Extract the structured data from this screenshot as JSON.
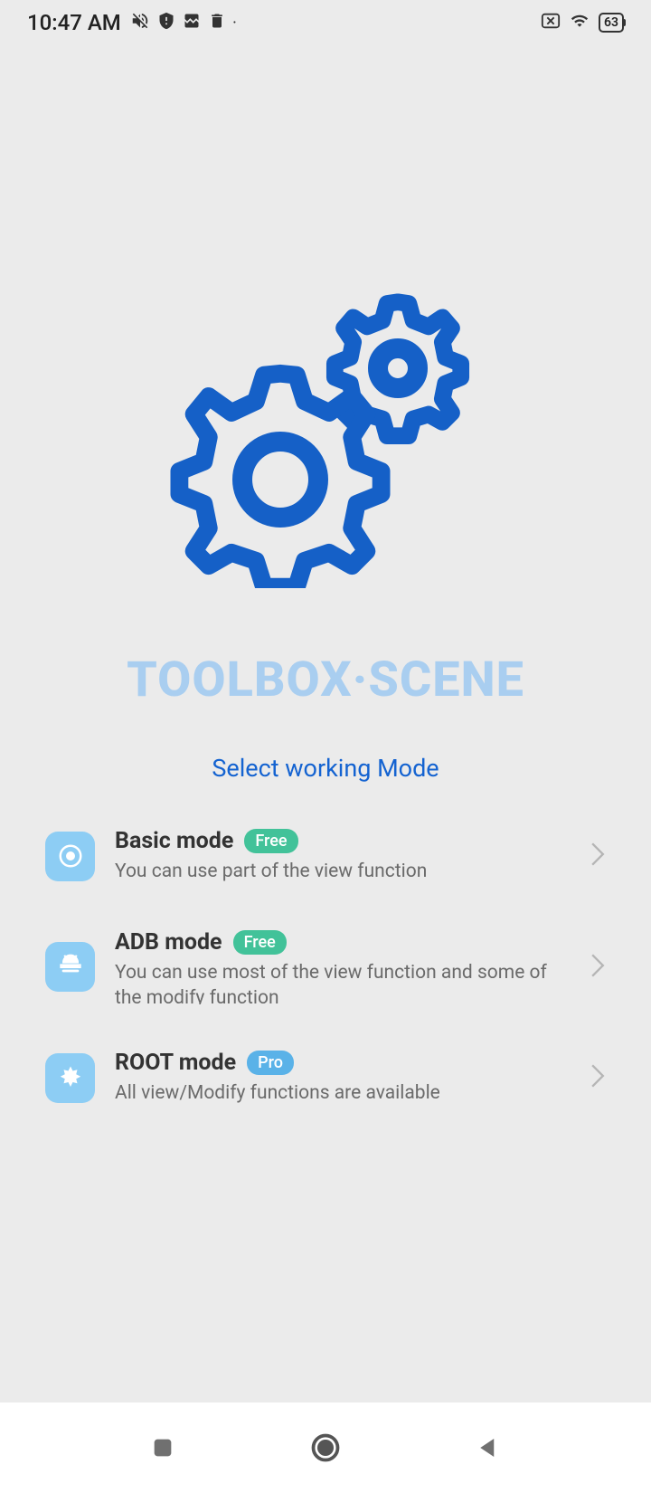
{
  "status_bar": {
    "time": "10:47 AM",
    "battery": "63"
  },
  "hero": {
    "title": "TOOLBOX·SCENE",
    "subtitle": "Select working Mode"
  },
  "modes": [
    {
      "title": "Basic mode",
      "badge": "Free",
      "badge_type": "free",
      "description": "You can use part of the view function"
    },
    {
      "title": "ADB mode",
      "badge": "Free",
      "badge_type": "free",
      "description": "You can use most of the view function and some of the modify function"
    },
    {
      "title": "ROOT mode",
      "badge": "Pro",
      "badge_type": "pro",
      "description": "All view/Modify functions are available"
    }
  ]
}
